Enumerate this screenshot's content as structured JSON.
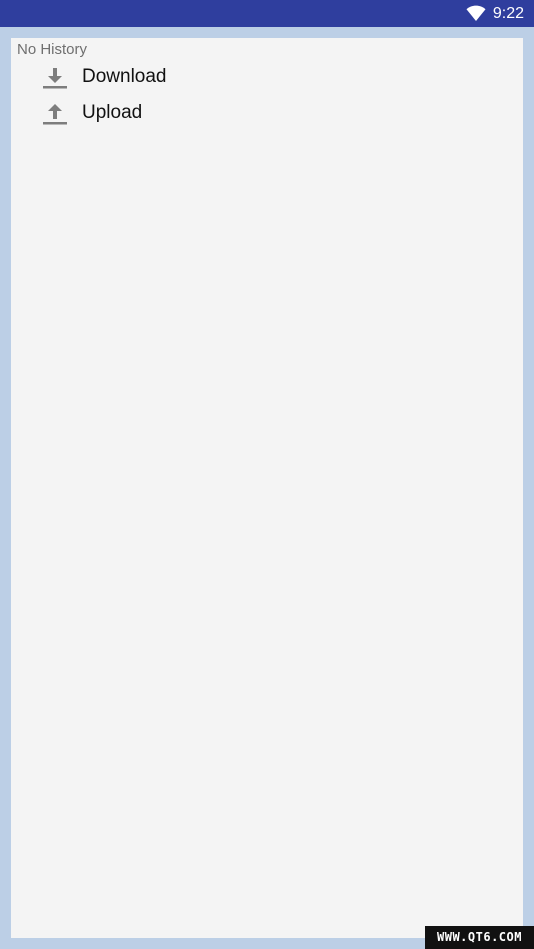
{
  "status_bar": {
    "time": "9:22",
    "wifi_icon": "wifi-icon",
    "background": "#2f3e9e"
  },
  "panel": {
    "history_label": "No History",
    "items": [
      {
        "label": "Download",
        "icon": "download-icon"
      },
      {
        "label": "Upload",
        "icon": "upload-icon"
      }
    ]
  },
  "watermark": {
    "text": "WWW.QT6.COM"
  },
  "colors": {
    "page_background": "#bccfe6",
    "panel_background": "#f4f4f4",
    "icon_gray": "#7d7d7d"
  }
}
